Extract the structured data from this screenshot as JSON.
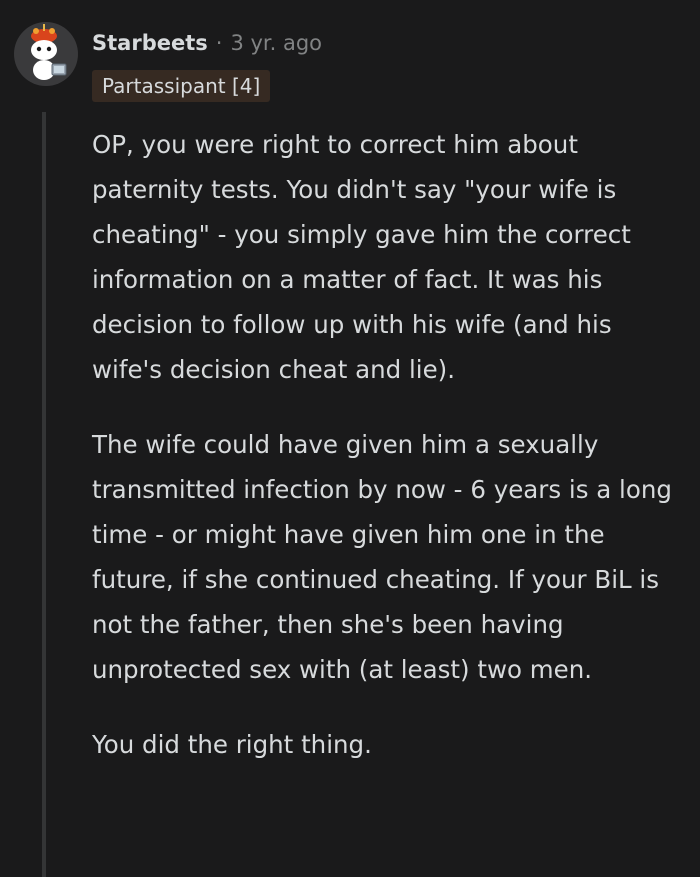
{
  "comment": {
    "author": "Starbeets",
    "separator": "·",
    "timestamp": "3 yr. ago",
    "flair": "Partassipant [4]",
    "paragraphs": [
      "OP, you were right to correct him about paternity tests. You didn't say \"your wife is cheating\" - you simply gave him the correct information on a matter of fact. It was his decision to follow up with his wife (and his wife's decision cheat and lie).",
      "The wife could have given him a sexually transmitted infection by now - 6 years is a long time - or might have given him one in the future, if she continued cheating. If your BiL is not the father, then she's been having unprotected sex with (at least) two men.",
      "You did the right thing."
    ]
  },
  "avatar": {
    "icon": "snoo-avatar-icon",
    "colors": {
      "hat": "#d9441c",
      "body": "#ffffff",
      "accent": "#e8b84a"
    }
  },
  "theme": {
    "background": "#1a1a1b",
    "text": "#d7dadc",
    "muted": "#818384",
    "flair_bg": "#362a22",
    "thread_line": "#343536"
  }
}
